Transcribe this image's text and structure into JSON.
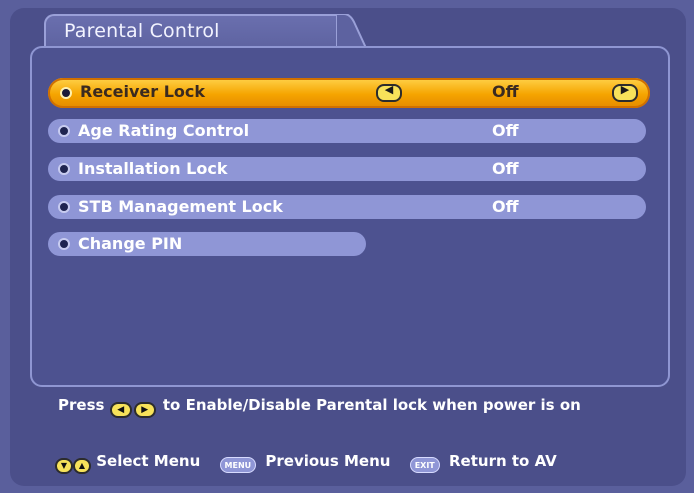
{
  "screen": {
    "title": "Parental Control",
    "colors": {
      "background": "#5a5f9c",
      "panel": "#4d5290",
      "row": "#8f96d6",
      "selected_row": "#f5a400",
      "key_yellow": "#f7e25a"
    }
  },
  "menu": {
    "items": [
      {
        "label": "Receiver Lock",
        "value": "Off",
        "selected": true
      },
      {
        "label": "Age Rating Control",
        "value": "Off"
      },
      {
        "label": "Installation Lock",
        "value": "Off"
      },
      {
        "label": "STB Management Lock",
        "value": "Off"
      },
      {
        "label": "Change PIN",
        "value": ""
      }
    ],
    "left_arrow_icon": "left-arrow-icon",
    "right_arrow_icon": "right-arrow-icon"
  },
  "hint": {
    "prefix": "Press",
    "text": "to Enable/Disable Parental lock when power is on"
  },
  "footer": {
    "select_label": "Select Menu",
    "menu_key": "MENU",
    "previous_label": "Previous Menu",
    "exit_key": "EXIT",
    "return_label": "Return to AV"
  }
}
